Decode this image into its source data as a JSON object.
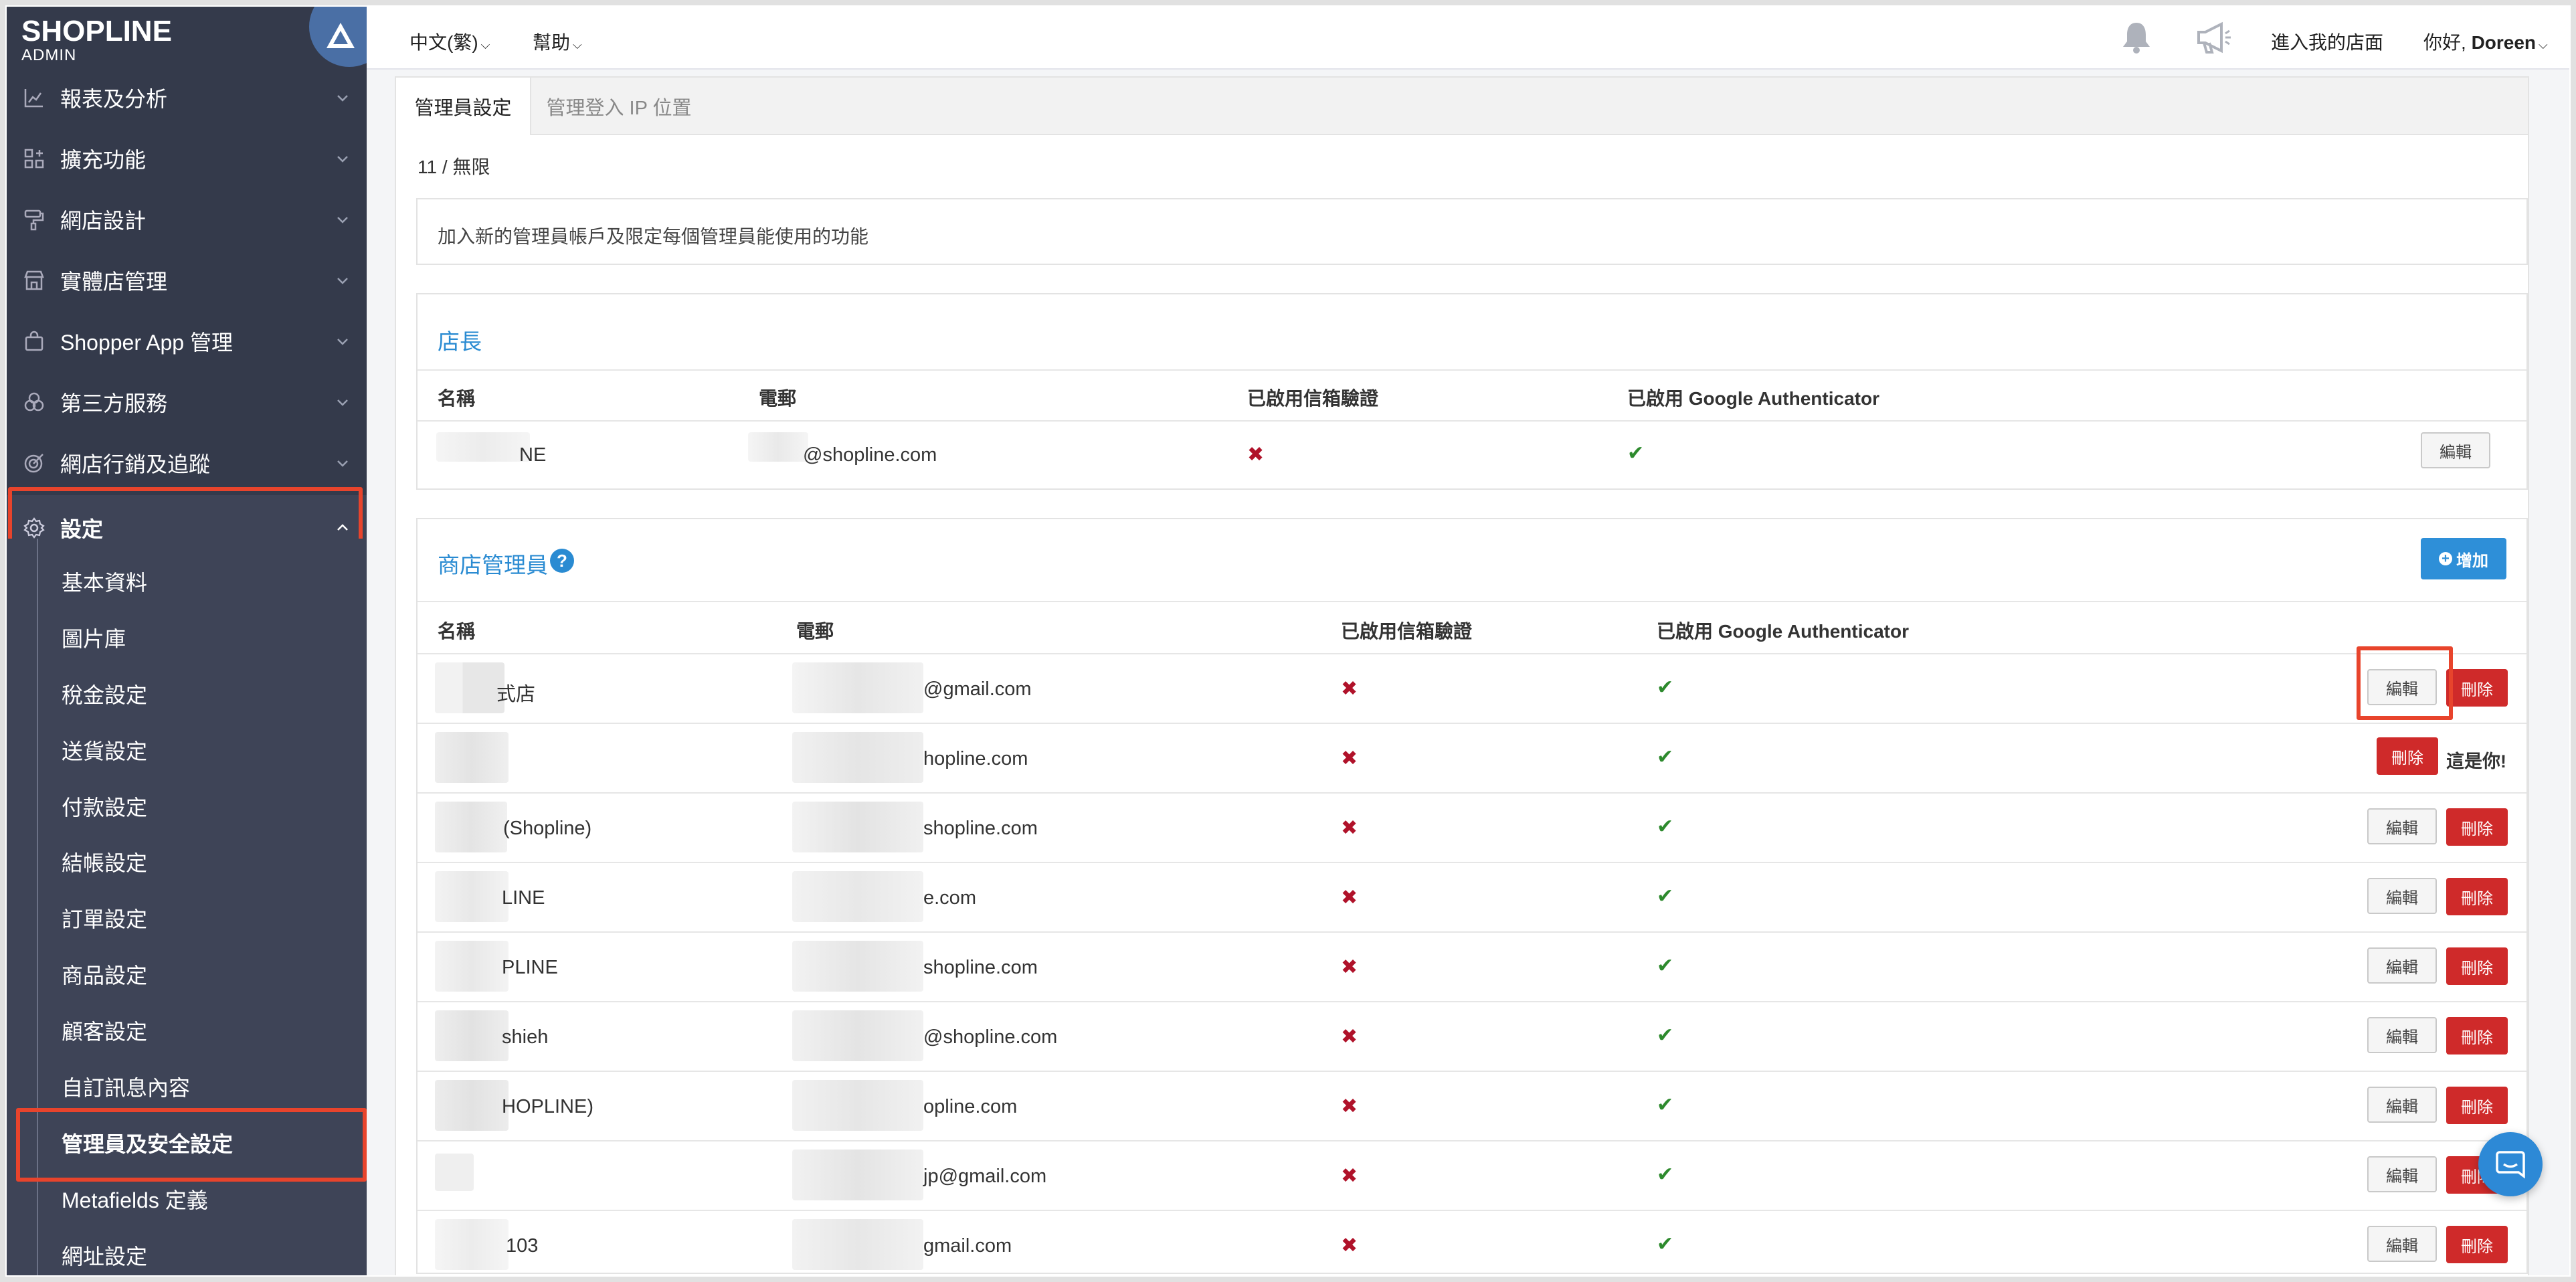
{
  "brand": {
    "line1": "SHOPLINE",
    "line2": "ADMIN"
  },
  "sidebar": {
    "items": [
      {
        "label": "報表及分析",
        "icon": "chart-icon"
      },
      {
        "label": "擴充功能",
        "icon": "apps-icon"
      },
      {
        "label": "網店設計",
        "icon": "paint-roller-icon"
      },
      {
        "label": "實體店管理",
        "icon": "store-icon"
      },
      {
        "label": "Shopper App 管理",
        "icon": "shopping-bag-icon"
      },
      {
        "label": "第三方服務",
        "icon": "circles-icon"
      },
      {
        "label": "網店行銷及追蹤",
        "icon": "target-icon"
      },
      {
        "label": "設定",
        "icon": "gear-icon",
        "expanded": true
      }
    ],
    "sub_items": [
      "基本資料",
      "圖片庫",
      "稅金設定",
      "送貨設定",
      "付款設定",
      "結帳設定",
      "訂單設定",
      "商品設定",
      "顧客設定",
      "自訂訊息內容",
      "管理員及安全設定",
      "Metafields 定義",
      "網址設定"
    ],
    "current_sub": "管理員及安全設定"
  },
  "topbar": {
    "language": "中文(繁)",
    "help": "幫助",
    "store_link": "進入我的店面",
    "greeting": "你好, ",
    "user": "Doreen"
  },
  "tabs": [
    "管理員設定",
    "管理登入 IP 位置"
  ],
  "count": "11 / 無限",
  "description": "加入新的管理員帳戶及限定每個管理員能使用的功能",
  "owner_section": {
    "title": "店長",
    "columns": [
      "名稱",
      "電郵",
      "已啟用信箱驗證",
      "已啟用 Google Authenticator"
    ],
    "row": {
      "name": "NE",
      "email": "@shopline.com",
      "email_verified": "✖",
      "google_auth": "✔",
      "edit": "編輯"
    }
  },
  "admin_section": {
    "title": "商店管理員",
    "help_icon": "?",
    "add_button": "增加",
    "columns": [
      "名稱",
      "電郵",
      "已啟用信箱驗證",
      "已啟用 Google Authenticator"
    ],
    "rows": [
      {
        "name": "式店",
        "email": "@gmail.com",
        "email_verified": "✖",
        "google_auth": "✔",
        "edit": "編輯",
        "delete": "刪除"
      },
      {
        "name": "",
        "email": "hopline.com",
        "email_verified": "✖",
        "google_auth": "✔",
        "delete": "刪除",
        "self_note": "這是你!"
      },
      {
        "name": "(Shopline)",
        "email": "shopline.com",
        "email_verified": "✖",
        "google_auth": "✔",
        "edit": "編輯",
        "delete": "刪除"
      },
      {
        "name": "LINE",
        "email": "e.com",
        "email_verified": "✖",
        "google_auth": "✔",
        "edit": "編輯",
        "delete": "刪除"
      },
      {
        "name": "PLINE",
        "email": "shopline.com",
        "email_verified": "✖",
        "google_auth": "✔",
        "edit": "編輯",
        "delete": "刪除"
      },
      {
        "name": "shieh",
        "email": "@shopline.com",
        "email_verified": "✖",
        "google_auth": "✔",
        "edit": "編輯",
        "delete": "刪除"
      },
      {
        "name": "HOPLINE)",
        "email": "opline.com",
        "email_verified": "✖",
        "google_auth": "✔",
        "edit": "編輯",
        "delete": "刪除"
      },
      {
        "name": "",
        "email": "jp@gmail.com",
        "email_verified": "✖",
        "google_auth": "✔",
        "edit": "編輯",
        "delete": "刪除"
      },
      {
        "name": "103",
        "email": "gmail.com",
        "email_verified": "✖",
        "google_auth": "✔",
        "edit": "編輯",
        "delete": "刪除"
      }
    ]
  },
  "colors": {
    "sidebar": "#343a4b",
    "accent": "#2a8bd2",
    "danger": "#cf2a2a",
    "highlight": "#e8442c",
    "check": "#2d8a2d",
    "cross": "#b0122a"
  }
}
